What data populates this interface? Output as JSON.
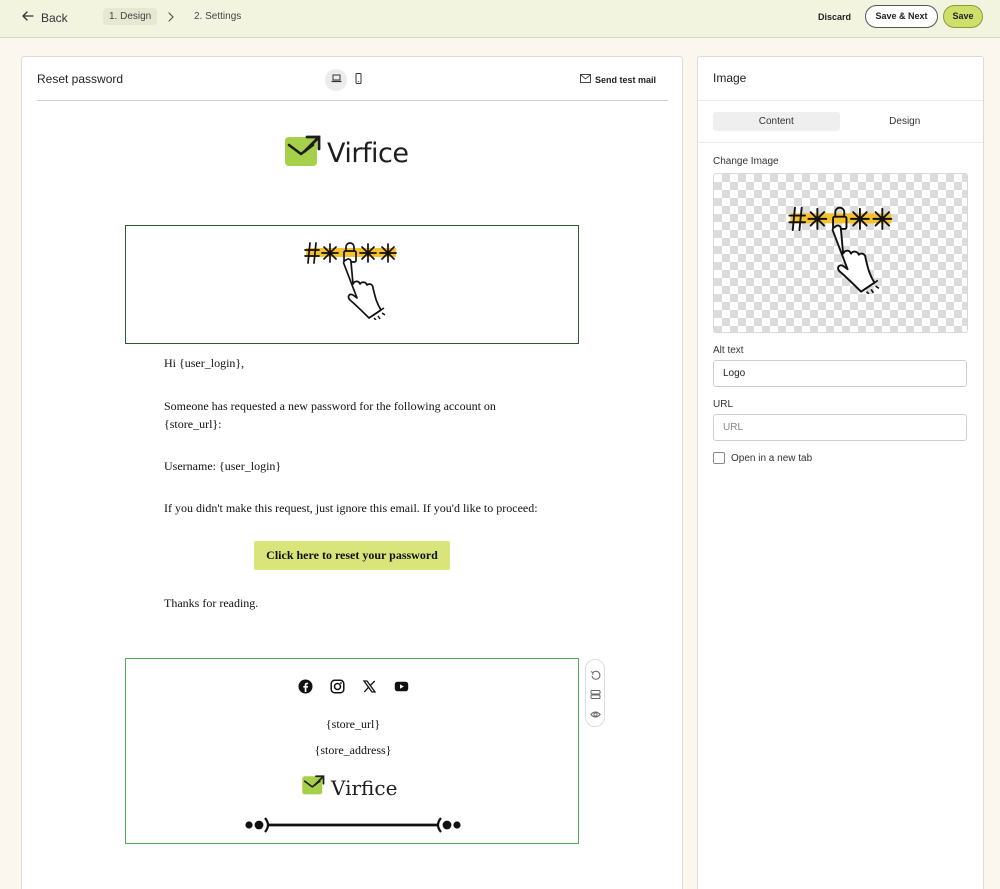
{
  "topbar": {
    "back_label": "Back",
    "step1_label": "1. Design",
    "step2_label": "2. Settings",
    "discard_label": "Discard",
    "save_next_label": "Save & Next",
    "save_label": "Save"
  },
  "editor": {
    "title": "Reset password",
    "send_test_label": "Send test mail",
    "brand_name": "Virfice",
    "email": {
      "greeting": "Hi {user_login},",
      "line1": "Someone has requested a new password for the following account on {store_url}:",
      "username_line": "Username: {user_login}",
      "ignore_line": "If you didn't make this request, just ignore this email. If you'd like to proceed:",
      "button_label": "Click here to reset your password",
      "closing": "Thanks for reading."
    },
    "footer": {
      "social_icons": [
        "facebook-icon",
        "instagram-icon",
        "x-icon",
        "youtube-icon"
      ],
      "store_url": "{store_url}",
      "store_address": "{store_address}",
      "brand_name": "Virfice"
    }
  },
  "settings": {
    "title": "Image",
    "tabs": [
      "Content",
      "Design"
    ],
    "active_tab": "Content",
    "change_image_label": "Change Image",
    "alt_text_label": "Alt text",
    "alt_text_value": "Logo",
    "url_label": "URL",
    "url_placeholder": "URL",
    "url_value": "",
    "open_new_tab_label": "Open in a new tab",
    "open_new_tab_checked": false
  },
  "colors": {
    "accent": "#cfe06a",
    "topbar_bg": "#f3f4df",
    "page_bg": "#fbf6ee",
    "brand_green": "#a6cf4a",
    "selected_border": "#4caf50",
    "hero_border": "#2d5a2d",
    "password_bar": "#f5c12e"
  }
}
